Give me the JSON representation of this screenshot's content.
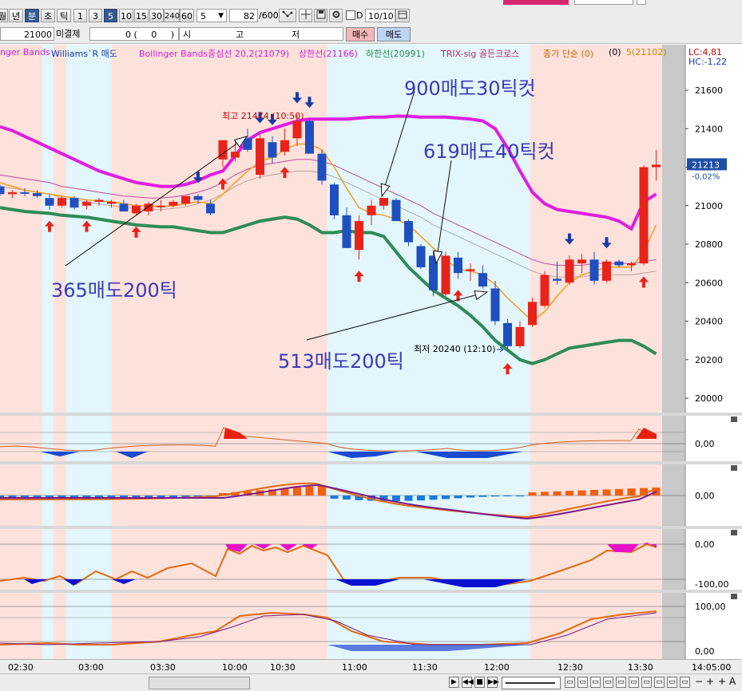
{
  "colors": {
    "up_candle": "#e8231a",
    "down_candle": "#1f4fbf",
    "upper_band": "#e01ee0",
    "lower_band": "#2e8b57",
    "middle_band": "#c04aa0",
    "ma_orange": "#f0a020",
    "buy_arrow": "#e8231a",
    "sell_arrow": "#1a3aa8",
    "bg_pink": "#fde2dc",
    "bg_cyan": "#e2f6fb",
    "annotation_text": "#3a3ab8"
  },
  "toolbar": {
    "period_buttons": [
      "월",
      "년",
      "분",
      "초",
      "틱",
      "1",
      "3",
      "5",
      "10",
      "15",
      "30",
      "240",
      "60"
    ],
    "selected_period": "분",
    "selected_interval": "5",
    "interval_select": "5",
    "count_input": "82",
    "count_total": "/600",
    "date_checkbox_label": "D",
    "date_value": "10/10"
  },
  "order_bar": {
    "price": "21000",
    "unfilled_label": "미결제",
    "unfilled_value": "0 (     0     )",
    "col_si": "시",
    "col_go": "고",
    "col_jeo": "저",
    "buy_label": "매수",
    "sell_label": "매도"
  },
  "legend": {
    "items": [
      {
        "text": "nger Bands",
        "color": "#d01ed0"
      },
      {
        "text": "Williams`R 매도",
        "color": "#1a3aa8"
      },
      {
        "text": "Bollinger Bands중심선 20,2(21079)",
        "color": "#d01ed0"
      },
      {
        "text": "상한선(21166)",
        "color": "#d01ed0"
      },
      {
        "text": "하한선(20991)",
        "color": "#2e8b57"
      },
      {
        "text": "TRIX-sig 골든크로스",
        "color": "#b03060"
      },
      {
        "text": "종가 단순 (0)",
        "color": "#c86400"
      },
      {
        "text": "(0)",
        "color": "#000000"
      },
      {
        "text": "5(21102)",
        "color": "#d08000"
      }
    ],
    "lc": "LC:4,81",
    "hc": "HC:-1,22"
  },
  "chart_data": [
    {
      "type": "candlestick",
      "title": "",
      "yticks": [
        20000,
        20200,
        20400,
        20600,
        20800,
        21000,
        21200,
        21400,
        21600
      ],
      "ylim": [
        19850,
        21720
      ],
      "xticks": [
        "02:30",
        "03:00",
        "03:30",
        "10:00",
        "10:30",
        "11:00",
        "11:30",
        "12:00",
        "12:30",
        "13:30",
        "14:05:00"
      ],
      "current_price": "21213",
      "current_change": "-0,02%",
      "high_label": "최고 21474 (10:50)",
      "low_label": "최저 20240 (12:10)",
      "candles": [
        {
          "o": 21100,
          "h": 21110,
          "l": 21050,
          "c": 21060
        },
        {
          "o": 21060,
          "h": 21080,
          "l": 21040,
          "c": 21070
        },
        {
          "o": 21070,
          "h": 21090,
          "l": 21050,
          "c": 21065
        },
        {
          "o": 21065,
          "h": 21080,
          "l": 21040,
          "c": 21050
        },
        {
          "o": 21040,
          "h": 21060,
          "l": 20980,
          "c": 21000
        },
        {
          "o": 21000,
          "h": 21050,
          "l": 20990,
          "c": 21040
        },
        {
          "o": 21040,
          "h": 21050,
          "l": 20980,
          "c": 20990
        },
        {
          "o": 21000,
          "h": 21030,
          "l": 20980,
          "c": 21020
        },
        {
          "o": 21020,
          "h": 21040,
          "l": 21000,
          "c": 21030
        },
        {
          "o": 21010,
          "h": 21030,
          "l": 20990,
          "c": 21020
        },
        {
          "o": 21010,
          "h": 21030,
          "l": 20970,
          "c": 20970
        },
        {
          "o": 20960,
          "h": 21010,
          "l": 20950,
          "c": 21000
        },
        {
          "o": 20970,
          "h": 21020,
          "l": 20950,
          "c": 21010
        },
        {
          "o": 21000,
          "h": 21030,
          "l": 20970,
          "c": 21000
        },
        {
          "o": 21000,
          "h": 21030,
          "l": 20990,
          "c": 21020
        },
        {
          "o": 21010,
          "h": 21050,
          "l": 21000,
          "c": 21050
        },
        {
          "o": 21050,
          "h": 21060,
          "l": 21010,
          "c": 21030
        },
        {
          "o": 21010,
          "h": 21030,
          "l": 20950,
          "c": 20960
        },
        {
          "o": 21240,
          "h": 21330,
          "l": 21200,
          "c": 21340
        },
        {
          "o": 21250,
          "h": 21340,
          "l": 21230,
          "c": 21280
        },
        {
          "o": 21350,
          "h": 21400,
          "l": 21280,
          "c": 21290
        },
        {
          "o": 21160,
          "h": 21370,
          "l": 21140,
          "c": 21350
        },
        {
          "o": 21330,
          "h": 21360,
          "l": 21220,
          "c": 21250
        },
        {
          "o": 21280,
          "h": 21400,
          "l": 21260,
          "c": 21340
        },
        {
          "o": 21350,
          "h": 21474,
          "l": 21310,
          "c": 21440
        },
        {
          "o": 21440,
          "h": 21450,
          "l": 21270,
          "c": 21270
        },
        {
          "o": 21270,
          "h": 21290,
          "l": 21110,
          "c": 21130
        },
        {
          "o": 21110,
          "h": 21120,
          "l": 20930,
          "c": 20950
        },
        {
          "o": 20950,
          "h": 20990,
          "l": 20780,
          "c": 20780
        },
        {
          "o": 20770,
          "h": 20950,
          "l": 20720,
          "c": 20920
        },
        {
          "o": 20950,
          "h": 21030,
          "l": 20900,
          "c": 21000
        },
        {
          "o": 21000,
          "h": 21040,
          "l": 20980,
          "c": 21040
        },
        {
          "o": 21030,
          "h": 21040,
          "l": 20920,
          "c": 20920
        },
        {
          "o": 20920,
          "h": 20930,
          "l": 20790,
          "c": 20810
        },
        {
          "o": 20790,
          "h": 20800,
          "l": 20670,
          "c": 20680
        },
        {
          "o": 20740,
          "h": 20760,
          "l": 20530,
          "c": 20560
        },
        {
          "o": 20540,
          "h": 20760,
          "l": 20530,
          "c": 20740
        },
        {
          "o": 20730,
          "h": 20760,
          "l": 20620,
          "c": 20650
        },
        {
          "o": 20660,
          "h": 20700,
          "l": 20610,
          "c": 20670
        },
        {
          "o": 20650,
          "h": 20690,
          "l": 20570,
          "c": 20580
        },
        {
          "o": 20570,
          "h": 20610,
          "l": 20380,
          "c": 20400
        },
        {
          "o": 20390,
          "h": 20410,
          "l": 20240,
          "c": 20270
        },
        {
          "o": 20270,
          "h": 20400,
          "l": 20260,
          "c": 20370
        },
        {
          "o": 20380,
          "h": 20520,
          "l": 20370,
          "c": 20500
        },
        {
          "o": 20480,
          "h": 20660,
          "l": 20470,
          "c": 20640
        },
        {
          "o": 20620,
          "h": 20710,
          "l": 20590,
          "c": 20610
        },
        {
          "o": 20600,
          "h": 20740,
          "l": 20590,
          "c": 20720
        },
        {
          "o": 20700,
          "h": 20750,
          "l": 20650,
          "c": 20720
        },
        {
          "o": 20720,
          "h": 20760,
          "l": 20590,
          "c": 20610
        },
        {
          "o": 20610,
          "h": 20720,
          "l": 20600,
          "c": 20710
        },
        {
          "o": 20710,
          "h": 20720,
          "l": 20680,
          "c": 20690
        },
        {
          "o": 20690,
          "h": 20710,
          "l": 20660,
          "c": 20700
        },
        {
          "o": 20700,
          "h": 21210,
          "l": 20690,
          "c": 21200
        },
        {
          "o": 21200,
          "h": 21290,
          "l": 21130,
          "c": 21213
        }
      ],
      "upper_band": [
        21410,
        21390,
        21360,
        21330,
        21300,
        21270,
        21240,
        21210,
        21180,
        21160,
        21140,
        21120,
        21110,
        21100,
        21100,
        21110,
        21130,
        21160,
        21180,
        21260,
        21340,
        21380,
        21400,
        21420,
        21440,
        21450,
        21450,
        21450,
        21450,
        21455,
        21460,
        21460,
        21465,
        21465,
        21460,
        21460,
        21460,
        21455,
        21450,
        21440,
        21400,
        21300,
        21180,
        21070,
        21010,
        20980,
        20970,
        20960,
        20950,
        20940,
        20920,
        20880,
        21020,
        21060
      ],
      "middle_band": [
        21160,
        21150,
        21140,
        21130,
        21120,
        21100,
        21090,
        21080,
        21070,
        21060,
        21050,
        21045,
        21040,
        21040,
        21045,
        21055,
        21070,
        21090,
        21120,
        21160,
        21190,
        21210,
        21220,
        21230,
        21240,
        21240,
        21230,
        21210,
        21180,
        21150,
        21120,
        21090,
        21060,
        21030,
        21000,
        20960,
        20930,
        20900,
        20870,
        20840,
        20810,
        20780,
        20750,
        20720,
        20700,
        20690,
        20690,
        20690,
        20700,
        20700,
        20700,
        20700,
        20710,
        20720
      ],
      "lower_band": [
        20990,
        20980,
        20970,
        20965,
        20960,
        20950,
        20945,
        20940,
        20930,
        20920,
        20910,
        20900,
        20895,
        20890,
        20890,
        20880,
        20870,
        20860,
        20860,
        20880,
        20900,
        20920,
        20930,
        20940,
        20930,
        20900,
        20860,
        20860,
        20870,
        20860,
        20860,
        20840,
        20760,
        20680,
        20620,
        20560,
        20520,
        20480,
        20430,
        20370,
        20300,
        20250,
        20200,
        20180,
        20200,
        20230,
        20260,
        20270,
        20280,
        20290,
        20300,
        20300,
        20270,
        20230
      ],
      "ma5": [
        21120,
        21100,
        21080,
        21070,
        21060,
        21050,
        21040,
        21030,
        21025,
        21020,
        21010,
        21000,
        21000,
        20995,
        21000,
        21010,
        21020,
        21010,
        21060,
        21120,
        21180,
        21230,
        21250,
        21290,
        21320,
        21320,
        21290,
        21200,
        21090,
        20990,
        20960,
        20950,
        20930,
        20900,
        20840,
        20780,
        20720,
        20670,
        20660,
        20640,
        20590,
        20520,
        20460,
        20400,
        20450,
        20530,
        20600,
        20640,
        20660,
        20680,
        20680,
        20680,
        20760,
        20900
      ],
      "buy_signals": [
        4,
        7,
        11,
        18,
        23,
        29,
        37,
        41,
        52
      ],
      "sell_signals": [
        16,
        21,
        22,
        24,
        25,
        46,
        49
      ],
      "annotations": [
        "900매도30틱컷",
        "619매도40틱컷",
        "365매도200틱",
        "513매도200틱"
      ]
    },
    {
      "type": "area",
      "title": "",
      "zero_label": "0,00"
    },
    {
      "type": "bar",
      "title": "",
      "zero_label": "0,00"
    },
    {
      "type": "area",
      "title": "",
      "labels": [
        "0,00",
        "-100,00"
      ]
    },
    {
      "type": "line",
      "title": "",
      "labels": [
        "100,00",
        "0,00"
      ]
    }
  ],
  "bottom": {
    "nav_buttons": [
      "▶",
      "◀◀",
      "■",
      "▶▶"
    ]
  }
}
